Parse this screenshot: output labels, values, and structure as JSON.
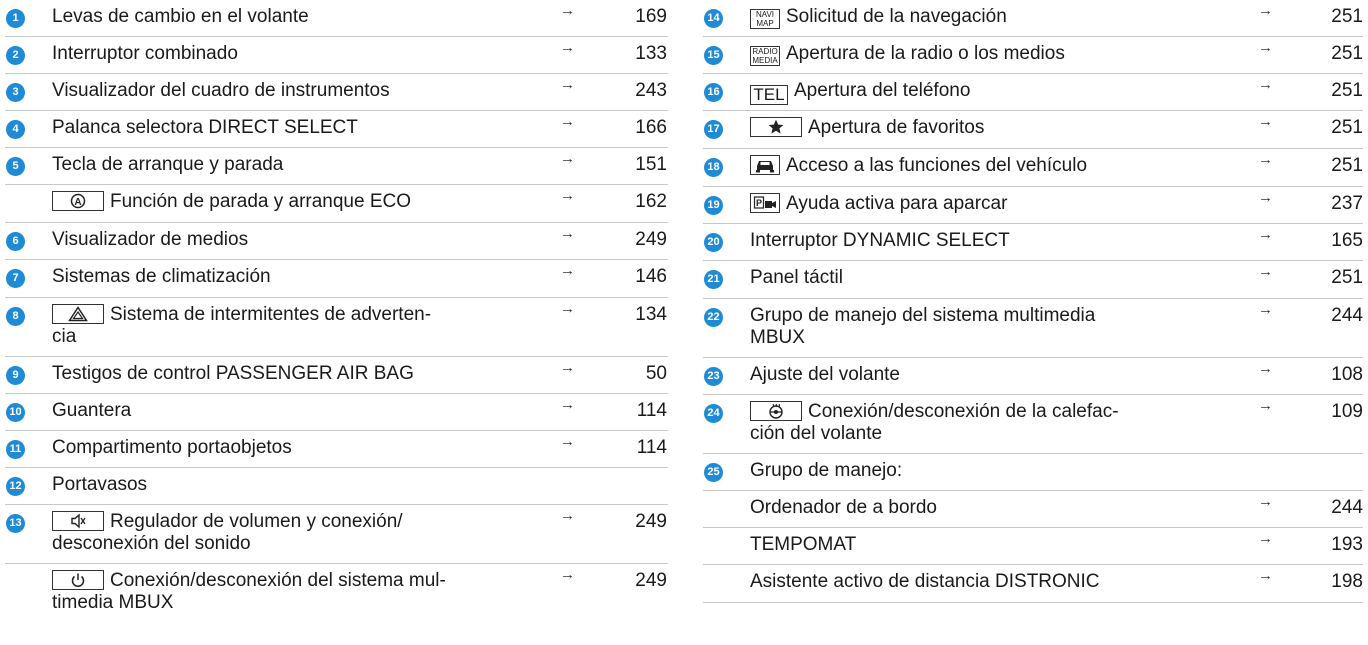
{
  "left": [
    {
      "badge": "1",
      "text": "Levas de cambio en el volante",
      "page": "169"
    },
    {
      "badge": "2",
      "text": "Interruptor combinado",
      "page": "133"
    },
    {
      "badge": "3",
      "text": "Visualizador del cuadro de instrumentos",
      "page": "243"
    },
    {
      "badge": "4",
      "text": "Palanca selectora DIRECT SELECT",
      "page": "166"
    },
    {
      "badge": "5",
      "text": "Tecla de arranque y parada",
      "page": "151"
    },
    {
      "badge": "",
      "key": "eco-start-stop-icon",
      "text": "Función de parada y arranque ECO",
      "page": "162"
    },
    {
      "badge": "6",
      "text": "Visualizador de medios",
      "page": "249"
    },
    {
      "badge": "7",
      "text": "Sistemas de climatización",
      "page": "146"
    },
    {
      "badge": "8",
      "key": "hazard-warning-icon",
      "text1": "Sistema de intermitentes de adverten-",
      "text2": "cia",
      "page": "134"
    },
    {
      "badge": "9",
      "text": "Testigos de control PASSENGER AIR BAG",
      "page": "50"
    },
    {
      "badge": "10",
      "text": "Guantera",
      "page": "114"
    },
    {
      "badge": "11",
      "text": "Compartimento portaobjetos",
      "page": "114"
    },
    {
      "badge": "12",
      "text": "Portavasos",
      "page": ""
    },
    {
      "badge": "13",
      "key": "volume-mute-icon",
      "text1": "Regulador de volumen y conexión/",
      "text2": "desconexión del sonido",
      "page": "249"
    },
    {
      "badge": "",
      "key": "power-icon",
      "text1": "Conexión/desconexión del sistema mul-",
      "text2": "timedia MBUX",
      "page": "249"
    }
  ],
  "right": [
    {
      "badge": "14",
      "keytext1": "NAVI",
      "keytext2": "MAP",
      "text": "Solicitud de la navegación",
      "page": "251"
    },
    {
      "badge": "15",
      "keytext1": "RADIO",
      "keytext2": "MEDIA",
      "text": "Apertura de la radio o los medios",
      "page": "251"
    },
    {
      "badge": "16",
      "keytext": "TEL",
      "text": "Apertura del teléfono",
      "page": "251"
    },
    {
      "badge": "17",
      "key": "star-icon",
      "text": "Apertura de favoritos",
      "page": "251"
    },
    {
      "badge": "18",
      "key": "car-icon",
      "text": "Acceso a las funciones del vehículo",
      "page": "251"
    },
    {
      "badge": "19",
      "key": "parking-camera-icon",
      "text": "Ayuda activa para aparcar",
      "page": "237"
    },
    {
      "badge": "20",
      "text": "Interruptor DYNAMIC SELECT",
      "page": "165"
    },
    {
      "badge": "21",
      "text": "Panel táctil",
      "page": "251"
    },
    {
      "badge": "22",
      "text1": "Grupo de manejo del sistema multimedia",
      "text2": "MBUX",
      "page": "244"
    },
    {
      "badge": "23",
      "text": "Ajuste del volante",
      "page": "108"
    },
    {
      "badge": "24",
      "key": "steering-heat-icon",
      "text1": "Conexión/desconexión de la calefac-",
      "text2": "ción del volante",
      "page": "109"
    },
    {
      "badge": "25",
      "text": "Grupo de manejo:",
      "page": ""
    },
    {
      "badge": "",
      "text": "Ordenador de a bordo",
      "page": "244"
    },
    {
      "badge": "",
      "text": "TEMPOMAT",
      "page": "193"
    },
    {
      "badge": "",
      "text": "Asistente activo de distancia DISTRONIC",
      "page": "198"
    }
  ],
  "arrow": "→"
}
